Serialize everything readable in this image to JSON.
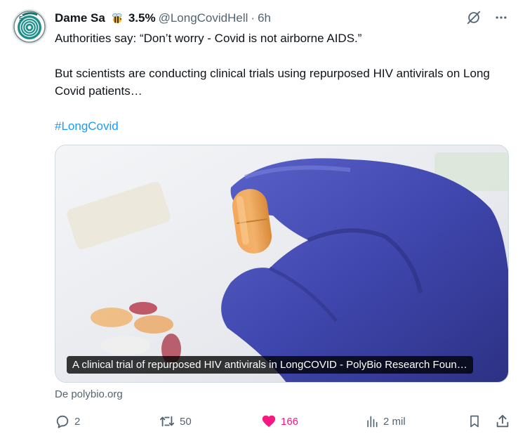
{
  "tweet": {
    "author_name": "Dame Sa",
    "author_emoji_icon": "bee-icon",
    "author_suffix": "3.5%",
    "handle": "@LongCovidHell",
    "separator": "·",
    "time": "6h",
    "text_line1": "Authorities say: “Don’t worry - Covid is not airborne AIDS.”",
    "text_line2": "But scientists are conducting clinical trials using repurposed HIV antivirals on Long Covid patients…",
    "hashtag": "#LongCovid"
  },
  "card": {
    "title": "A clinical trial of repurposed HIV antivirals in LongCOVID - PolyBio Research Foun…",
    "source": "De polybio.org"
  },
  "actions": {
    "replies": "2",
    "retweets": "50",
    "likes": "166",
    "views": "2 mil"
  },
  "colors": {
    "accent": "#1d9bf0",
    "like": "#f91880",
    "muted": "#536471",
    "text": "#0f1419"
  }
}
